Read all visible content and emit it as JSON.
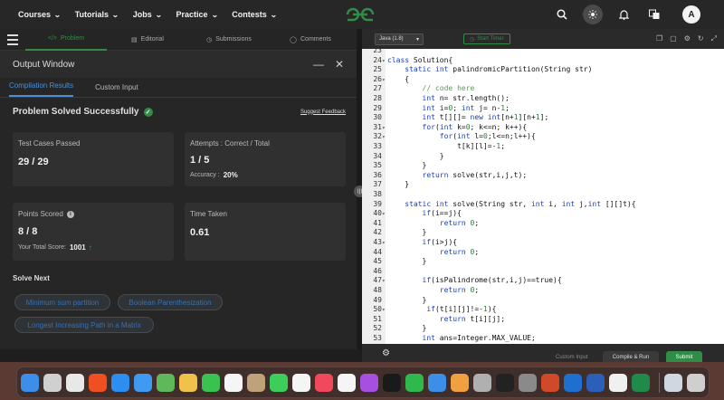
{
  "nav": {
    "links": [
      "Courses",
      "Tutorials",
      "Jobs",
      "Practice",
      "Contests"
    ],
    "avatar": "A",
    "colors": {
      "brand": "#2f8d46",
      "bg": "#272727"
    }
  },
  "tabs": [
    {
      "icon": "</>",
      "label": "Problem",
      "active": true
    },
    {
      "icon": "▤",
      "label": "Editorial",
      "active": false
    },
    {
      "icon": "◷",
      "label": "Submissions",
      "active": false
    },
    {
      "icon": "◯",
      "label": "Comments",
      "active": false
    }
  ],
  "output": {
    "title": "Output Window",
    "tabs": [
      "Compilation Results",
      "Custom Input"
    ],
    "status": "Problem Solved Successfully",
    "feedback": "Suggest Feedback",
    "cards": {
      "tests": {
        "label": "Test Cases Passed",
        "value": "29 / 29"
      },
      "attempts": {
        "label": "Attempts : Correct / Total",
        "value": "1 / 5",
        "sub_label": "Accuracy :",
        "sub_value": "20%"
      },
      "points": {
        "label": "Points Scored",
        "value": "8 / 8",
        "sub_label": "Your Total Score:",
        "sub_value": "1001"
      },
      "time": {
        "label": "Time Taken",
        "value": "0.61"
      }
    },
    "solve_next": "Solve Next",
    "suggestions": [
      "Minimum sum partition",
      "Boolean Parenthesization",
      "Longest Increasing Path in a Matrix"
    ]
  },
  "editor": {
    "language": "Java (1.8)",
    "timer": "Start Timer",
    "lines": [
      {
        "n": "23",
        "t": ""
      },
      {
        "n": "24",
        "t": "class Solution{"
      },
      {
        "n": "25",
        "t": "    static int palindromicPartition(String str)"
      },
      {
        "n": "26",
        "t": "    {"
      },
      {
        "n": "27",
        "t": "        // code here"
      },
      {
        "n": "28",
        "t": "        int n= str.length();"
      },
      {
        "n": "29",
        "t": "        int i=0; int j= n-1;"
      },
      {
        "n": "30",
        "t": "        int t[][]= new int[n+1][n+1];"
      },
      {
        "n": "31",
        "t": "        for(int k=0; k<=n; k++){"
      },
      {
        "n": "32",
        "t": "            for(int l=0;l<=n;l++){"
      },
      {
        "n": "33",
        "t": "                t[k][l]=-1;"
      },
      {
        "n": "34",
        "t": "            }"
      },
      {
        "n": "35",
        "t": "        }"
      },
      {
        "n": "36",
        "t": "        return solve(str,i,j,t);"
      },
      {
        "n": "37",
        "t": "    }"
      },
      {
        "n": "38",
        "t": ""
      },
      {
        "n": "39",
        "t": "    static int solve(String str, int i, int j,int [][]t){"
      },
      {
        "n": "40",
        "t": "        if(i==j){"
      },
      {
        "n": "41",
        "t": "            return 0;"
      },
      {
        "n": "42",
        "t": "        }"
      },
      {
        "n": "43",
        "t": "        if(i>j){"
      },
      {
        "n": "44",
        "t": "            return 0;"
      },
      {
        "n": "45",
        "t": "        }"
      },
      {
        "n": "46",
        "t": ""
      },
      {
        "n": "47",
        "t": "        if(isPalindrome(str,i,j)==true){"
      },
      {
        "n": "48",
        "t": "            return 0;"
      },
      {
        "n": "49",
        "t": "        }"
      },
      {
        "n": "50",
        "t": "         if(t[i][j]!=-1){"
      },
      {
        "n": "51",
        "t": "            return t[i][j];"
      },
      {
        "n": "52",
        "t": "        }"
      },
      {
        "n": "53",
        "t": "        int ans=Integer.MAX_VALUE;"
      }
    ],
    "custom_input": "Custom Input",
    "compile": "Compile & Run",
    "submit": "Submit"
  },
  "dock": {
    "apps": [
      {
        "name": "finder",
        "color": "#3d8ee8"
      },
      {
        "name": "launchpad",
        "color": "#d0d0d0"
      },
      {
        "name": "chrome",
        "color": "#e8e8e8"
      },
      {
        "name": "brave",
        "color": "#f04f23"
      },
      {
        "name": "safari",
        "color": "#2c8ef0"
      },
      {
        "name": "mail",
        "color": "#3f9bf2"
      },
      {
        "name": "maps",
        "color": "#5fb85a"
      },
      {
        "name": "photos",
        "color": "#f0c24a"
      },
      {
        "name": "facetime",
        "color": "#39c24f"
      },
      {
        "name": "calendar",
        "color": "#f5f5f5"
      },
      {
        "name": "contacts",
        "color": "#bda27a"
      },
      {
        "name": "messages",
        "color": "#3ccd5a"
      },
      {
        "name": "reminders",
        "color": "#f5f5f5"
      },
      {
        "name": "music",
        "color": "#f1485c"
      },
      {
        "name": "news",
        "color": "#f5f5f5"
      },
      {
        "name": "podcasts",
        "color": "#a74fe0"
      },
      {
        "name": "tv",
        "color": "#1a1a1a"
      },
      {
        "name": "numbers",
        "color": "#2fb84b"
      },
      {
        "name": "keynote",
        "color": "#3d8ee8"
      },
      {
        "name": "pages",
        "color": "#f0a040"
      },
      {
        "name": "notes",
        "color": "#b0b0b0"
      },
      {
        "name": "terminal",
        "color": "#222222"
      },
      {
        "name": "settings",
        "color": "#8a8a8a"
      },
      {
        "name": "powerpoint",
        "color": "#d04a2a"
      },
      {
        "name": "outlook",
        "color": "#1f6fd1"
      },
      {
        "name": "word",
        "color": "#2b5fb8"
      },
      {
        "name": "piano",
        "color": "#f0f0f0"
      },
      {
        "name": "excel",
        "color": "#1f8a4a"
      },
      {
        "name": "downloads",
        "color": "#cfd8e0"
      },
      {
        "name": "trash",
        "color": "#cfcfcf"
      }
    ]
  }
}
